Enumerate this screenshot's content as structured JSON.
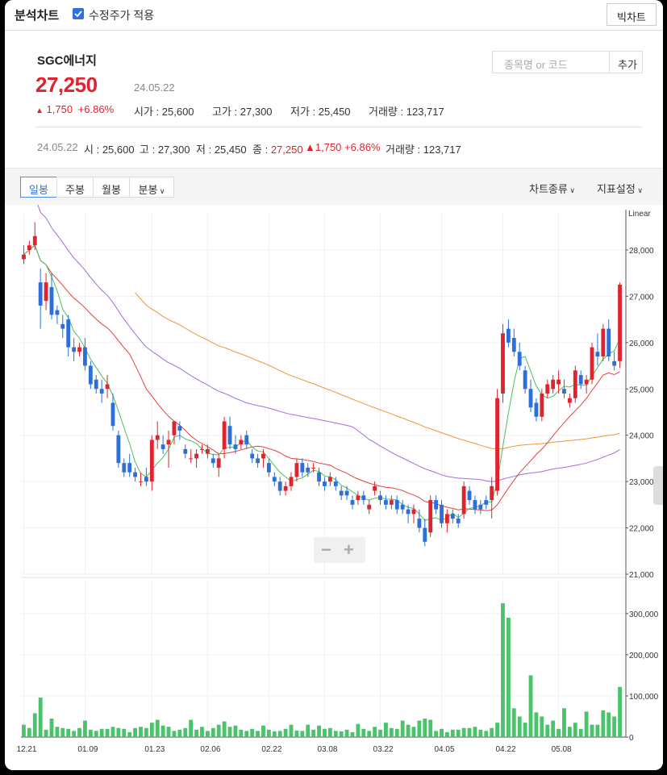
{
  "topbar": {
    "title": "분석차트",
    "adjusted_label": "수정주가 적용",
    "adjusted_checked": true,
    "big_chart_label": "빅차트"
  },
  "stock": {
    "name": "SGC에너지",
    "price": "27,250",
    "date": "24.05.22",
    "change": "1,750",
    "change_pct": "+6.86%",
    "open_label": "시가",
    "open": "25,600",
    "high_label": "고가",
    "high": "27,300",
    "low_label": "저가",
    "low": "25,450",
    "vol_label": "거래량",
    "volume": "123,717"
  },
  "search": {
    "placeholder": "종목명 or 코드",
    "add_label": "추가"
  },
  "summary": {
    "date": "24.05.22",
    "o_label": "시",
    "o": "25,600",
    "h_label": "고",
    "h": "27,300",
    "l_label": "저",
    "l": "25,450",
    "c_label": "종",
    "c": "27,250",
    "change": "1,750",
    "change_pct": "+6.86%",
    "vol_label": "거래량",
    "vol": "123,717"
  },
  "toolbar": {
    "tabs": [
      "일봉",
      "주봉",
      "월봉",
      "분봉"
    ],
    "active_tab": "일봉",
    "chart_type_label": "차트종류",
    "indicator_label": "지표설정"
  },
  "colors": {
    "up": "#e0242f",
    "down": "#2c6fd9",
    "volume": "#49c46b",
    "ma5": "#4cc060",
    "ma20": "#e4423c",
    "ma60": "#a66be0",
    "ma120": "#f0963a"
  },
  "chart_data": {
    "type": "candlestick",
    "scale_label": "Linear",
    "price_axis_ticks": [
      "28,000",
      "27,000",
      "26,000",
      "25,000",
      "24,000",
      "23,000",
      "22,000",
      "21,000"
    ],
    "volume_axis_ticks": [
      "300,000",
      "200,000",
      "100,000",
      "0"
    ],
    "ylim": [
      21000,
      28800
    ],
    "vol_ylim": [
      0,
      380000
    ],
    "x_labels": [
      "12.21",
      "01.09",
      "01.23",
      "02.06",
      "02.22",
      "03.08",
      "03.22",
      "04.05",
      "04.22",
      "05.08"
    ],
    "x_label_index": [
      0,
      11,
      23,
      33,
      44,
      54,
      64,
      75,
      86,
      96
    ],
    "ohlc": [
      [
        27800,
        28100,
        27700,
        27900
      ],
      [
        28000,
        28200,
        27900,
        28100
      ],
      [
        28100,
        28600,
        28000,
        28300
      ],
      [
        27300,
        27600,
        26300,
        26800
      ],
      [
        26900,
        27500,
        26700,
        27300
      ],
      [
        27200,
        27500,
        26500,
        26600
      ],
      [
        26700,
        26800,
        26400,
        26600
      ],
      [
        26400,
        26600,
        26100,
        26300
      ],
      [
        26500,
        26600,
        25700,
        25900
      ],
      [
        25900,
        26100,
        25600,
        25800
      ],
      [
        25800,
        26000,
        25700,
        25900
      ],
      [
        25900,
        26100,
        25400,
        25500
      ],
      [
        25500,
        25600,
        25000,
        25100
      ],
      [
        25200,
        25300,
        24900,
        25000
      ],
      [
        25000,
        25200,
        24700,
        24900
      ],
      [
        25000,
        25300,
        24800,
        25100
      ],
      [
        24700,
        24900,
        24100,
        24200
      ],
      [
        24000,
        24100,
        23300,
        23400
      ],
      [
        23400,
        23500,
        23100,
        23200
      ],
      [
        23400,
        23600,
        23100,
        23200
      ],
      [
        23200,
        23300,
        23000,
        23100
      ],
      [
        23000,
        23200,
        22900,
        23000
      ],
      [
        23100,
        23300,
        22900,
        23000
      ],
      [
        23000,
        24000,
        22800,
        23900
      ],
      [
        23900,
        24300,
        23700,
        24000
      ],
      [
        23800,
        24000,
        23600,
        23700
      ],
      [
        23800,
        24100,
        23300,
        23900
      ],
      [
        24000,
        24200,
        23800,
        24300
      ],
      [
        24200,
        24300,
        23900,
        24100
      ],
      [
        23700,
        23800,
        23500,
        23600
      ],
      [
        23500,
        23700,
        23400,
        23500
      ],
      [
        23500,
        23700,
        23300,
        23600
      ],
      [
        23700,
        23800,
        23600,
        23700
      ],
      [
        23600,
        23800,
        23500,
        23700
      ],
      [
        23500,
        23600,
        23300,
        23400
      ],
      [
        23300,
        23600,
        23100,
        23500
      ],
      [
        23700,
        24400,
        23500,
        24300
      ],
      [
        24200,
        24400,
        23700,
        23800
      ],
      [
        23800,
        24000,
        23600,
        23700
      ],
      [
        23800,
        24000,
        23700,
        23900
      ],
      [
        24000,
        24100,
        23700,
        23800
      ],
      [
        23600,
        23700,
        23400,
        23500
      ],
      [
        23500,
        23600,
        23300,
        23400
      ],
      [
        23500,
        23700,
        23300,
        23600
      ],
      [
        23400,
        23500,
        23100,
        23200
      ],
      [
        23100,
        23200,
        22900,
        23000
      ],
      [
        23000,
        23100,
        22700,
        22800
      ],
      [
        22800,
        23000,
        22700,
        22900
      ],
      [
        22900,
        23200,
        22800,
        23100
      ],
      [
        23100,
        23500,
        23000,
        23400
      ],
      [
        23400,
        23500,
        23100,
        23200
      ],
      [
        23300,
        23400,
        23100,
        23200
      ],
      [
        23300,
        23400,
        23200,
        23300
      ],
      [
        23200,
        23300,
        22900,
        23000
      ],
      [
        23000,
        23100,
        22800,
        22900
      ],
      [
        23000,
        23200,
        22900,
        23100
      ],
      [
        23000,
        23100,
        22800,
        22900
      ],
      [
        22800,
        22900,
        22600,
        22700
      ],
      [
        22800,
        22900,
        22600,
        22700
      ],
      [
        22600,
        22700,
        22400,
        22500
      ],
      [
        22600,
        22800,
        22500,
        22700
      ],
      [
        22700,
        22800,
        22500,
        22600
      ],
      [
        22400,
        22600,
        22300,
        22500
      ],
      [
        22800,
        23000,
        22700,
        22900
      ],
      [
        22700,
        22800,
        22500,
        22600
      ],
      [
        22600,
        22700,
        22400,
        22500
      ],
      [
        22500,
        22700,
        22400,
        22600
      ],
      [
        22600,
        22700,
        22300,
        22400
      ],
      [
        22500,
        22600,
        22300,
        22400
      ],
      [
        22400,
        22500,
        22100,
        22300
      ],
      [
        22300,
        22500,
        22100,
        22400
      ],
      [
        22200,
        22400,
        21900,
        22000
      ],
      [
        22000,
        22200,
        21600,
        21700
      ],
      [
        21900,
        22700,
        21800,
        22600
      ],
      [
        22600,
        22700,
        22300,
        22400
      ],
      [
        22500,
        22600,
        22000,
        22100
      ],
      [
        22100,
        22400,
        21900,
        22300
      ],
      [
        22300,
        22400,
        22100,
        22200
      ],
      [
        22200,
        22300,
        22000,
        22100
      ],
      [
        22300,
        23000,
        22200,
        22900
      ],
      [
        22800,
        22900,
        22500,
        22600
      ],
      [
        22600,
        22700,
        22300,
        22400
      ],
      [
        22500,
        22600,
        22300,
        22400
      ],
      [
        22600,
        22700,
        22400,
        22500
      ],
      [
        22600,
        23100,
        22200,
        22900
      ],
      [
        22800,
        25000,
        22700,
        24800
      ],
      [
        24900,
        26400,
        24700,
        26200
      ],
      [
        26300,
        26500,
        25900,
        26000
      ],
      [
        26100,
        26300,
        25700,
        25800
      ],
      [
        25800,
        26000,
        25400,
        25500
      ],
      [
        25400,
        25500,
        24900,
        25000
      ],
      [
        25000,
        25200,
        24500,
        24600
      ],
      [
        24700,
        24800,
        24300,
        24400
      ],
      [
        24400,
        25000,
        24300,
        24900
      ],
      [
        24900,
        25200,
        24800,
        25100
      ],
      [
        25000,
        25300,
        24900,
        25200
      ],
      [
        25100,
        25400,
        24900,
        25200
      ],
      [
        25000,
        25200,
        24800,
        24900
      ],
      [
        24700,
        24900,
        24600,
        24800
      ],
      [
        24800,
        25500,
        24700,
        25400
      ],
      [
        25300,
        25400,
        25000,
        25100
      ],
      [
        25100,
        25300,
        24900,
        25200
      ],
      [
        25200,
        26000,
        25100,
        25900
      ],
      [
        25800,
        26200,
        25500,
        25700
      ],
      [
        25700,
        26400,
        25600,
        26300
      ],
      [
        26300,
        26500,
        25600,
        25700
      ],
      [
        25600,
        25800,
        25400,
        25500
      ],
      [
        25600,
        27300,
        25450,
        27250
      ]
    ],
    "volume": [
      30000,
      22000,
      58000,
      96000,
      18000,
      45000,
      25000,
      22000,
      20000,
      15000,
      22000,
      40000,
      18000,
      15000,
      20000,
      20000,
      25000,
      22000,
      20000,
      12000,
      22000,
      25000,
      22000,
      35000,
      42000,
      28000,
      25000,
      15000,
      18000,
      22000,
      42000,
      18000,
      25000,
      15000,
      22000,
      30000,
      38000,
      25000,
      28000,
      18000,
      15000,
      20000,
      15000,
      28000,
      18000,
      14000,
      15000,
      20000,
      30000,
      16000,
      15000,
      30000,
      18000,
      28000,
      20000,
      22000,
      15000,
      14000,
      18000,
      12000,
      32000,
      20000,
      15000,
      25000,
      18000,
      35000,
      22000,
      20000,
      40000,
      30000,
      25000,
      40000,
      45000,
      42000,
      15000,
      20000,
      12000,
      18000,
      18000,
      22000,
      22000,
      25000,
      18000,
      15000,
      22000,
      35000,
      325000,
      290000,
      70000,
      50000,
      35000,
      150000,
      60000,
      50000,
      30000,
      40000,
      20000,
      70000,
      25000,
      35000,
      20000,
      62000,
      30000,
      30000,
      65000,
      60000,
      50000,
      122000
    ]
  }
}
